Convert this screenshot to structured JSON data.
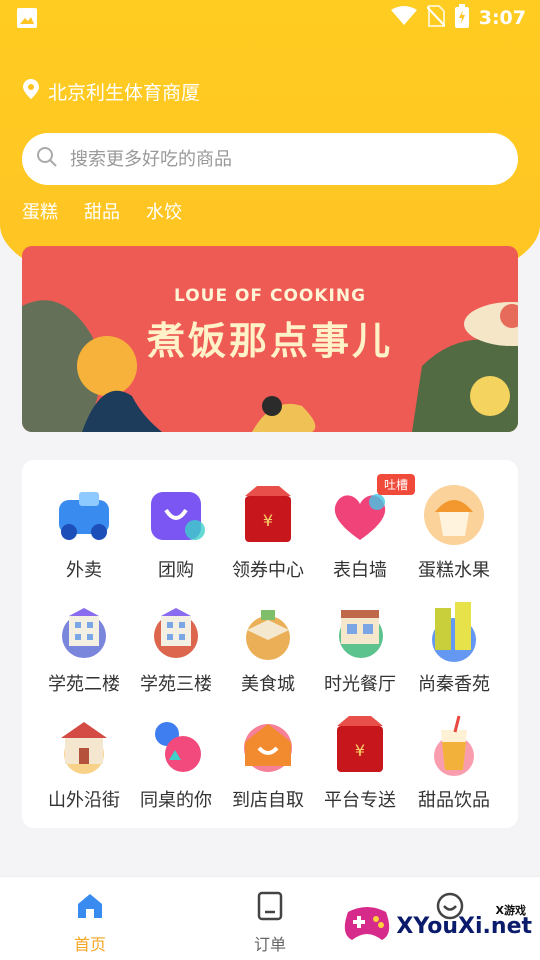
{
  "status_bar": {
    "time": "3:07"
  },
  "location": {
    "text": "北京利生体育商厦"
  },
  "search": {
    "placeholder": "搜索更多好吃的商品"
  },
  "hot_tags": [
    "蛋糕",
    "甜品",
    "水饺"
  ],
  "banner": {
    "subtitle": "LOUE OF COOKING",
    "title": "煮饭那点事儿"
  },
  "categories": [
    {
      "label": "外卖",
      "icon": "scooter-icon",
      "color": "#3a8bf0"
    },
    {
      "label": "团购",
      "icon": "shopping-bag-icon",
      "color": "#7b56f2"
    },
    {
      "label": "领券中心",
      "icon": "coupon-box-icon",
      "color": "#c8171c"
    },
    {
      "label": "表白墙",
      "icon": "heart-icon",
      "color": "#f0437a",
      "badge": "吐槽"
    },
    {
      "label": "蛋糕水果",
      "icon": "cupcake-icon",
      "color": "#f2982f"
    },
    {
      "label": "学苑二楼",
      "icon": "building-icon",
      "color": "#6b78d8"
    },
    {
      "label": "学苑三楼",
      "icon": "building-icon",
      "color": "#d8553b"
    },
    {
      "label": "美食城",
      "icon": "food-court-icon",
      "color": "#e8a23a"
    },
    {
      "label": "时光餐厅",
      "icon": "restaurant-icon",
      "color": "#3fb77a"
    },
    {
      "label": "尚秦香苑",
      "icon": "tower-icon",
      "color": "#c8cf3b"
    },
    {
      "label": "山外沿街",
      "icon": "shop-icon",
      "color": "#d34b44"
    },
    {
      "label": "同桌的你",
      "icon": "friends-icon",
      "color": "#3f7ef0"
    },
    {
      "label": "到店自取",
      "icon": "house-icon",
      "color": "#f28a2f"
    },
    {
      "label": "平台专送",
      "icon": "coupon-box-icon",
      "color": "#c8171c"
    },
    {
      "label": "甜品饮品",
      "icon": "drink-cup-icon",
      "color": "#f2b13a"
    }
  ],
  "tabbar": [
    {
      "label": "首页",
      "icon": "home-icon",
      "active": true
    },
    {
      "label": "订单",
      "icon": "order-icon",
      "active": false
    },
    {
      "label": "",
      "icon": "smile-icon",
      "active": false
    }
  ],
  "watermark": {
    "small": "X游戏",
    "text": "XYouXi.net"
  }
}
